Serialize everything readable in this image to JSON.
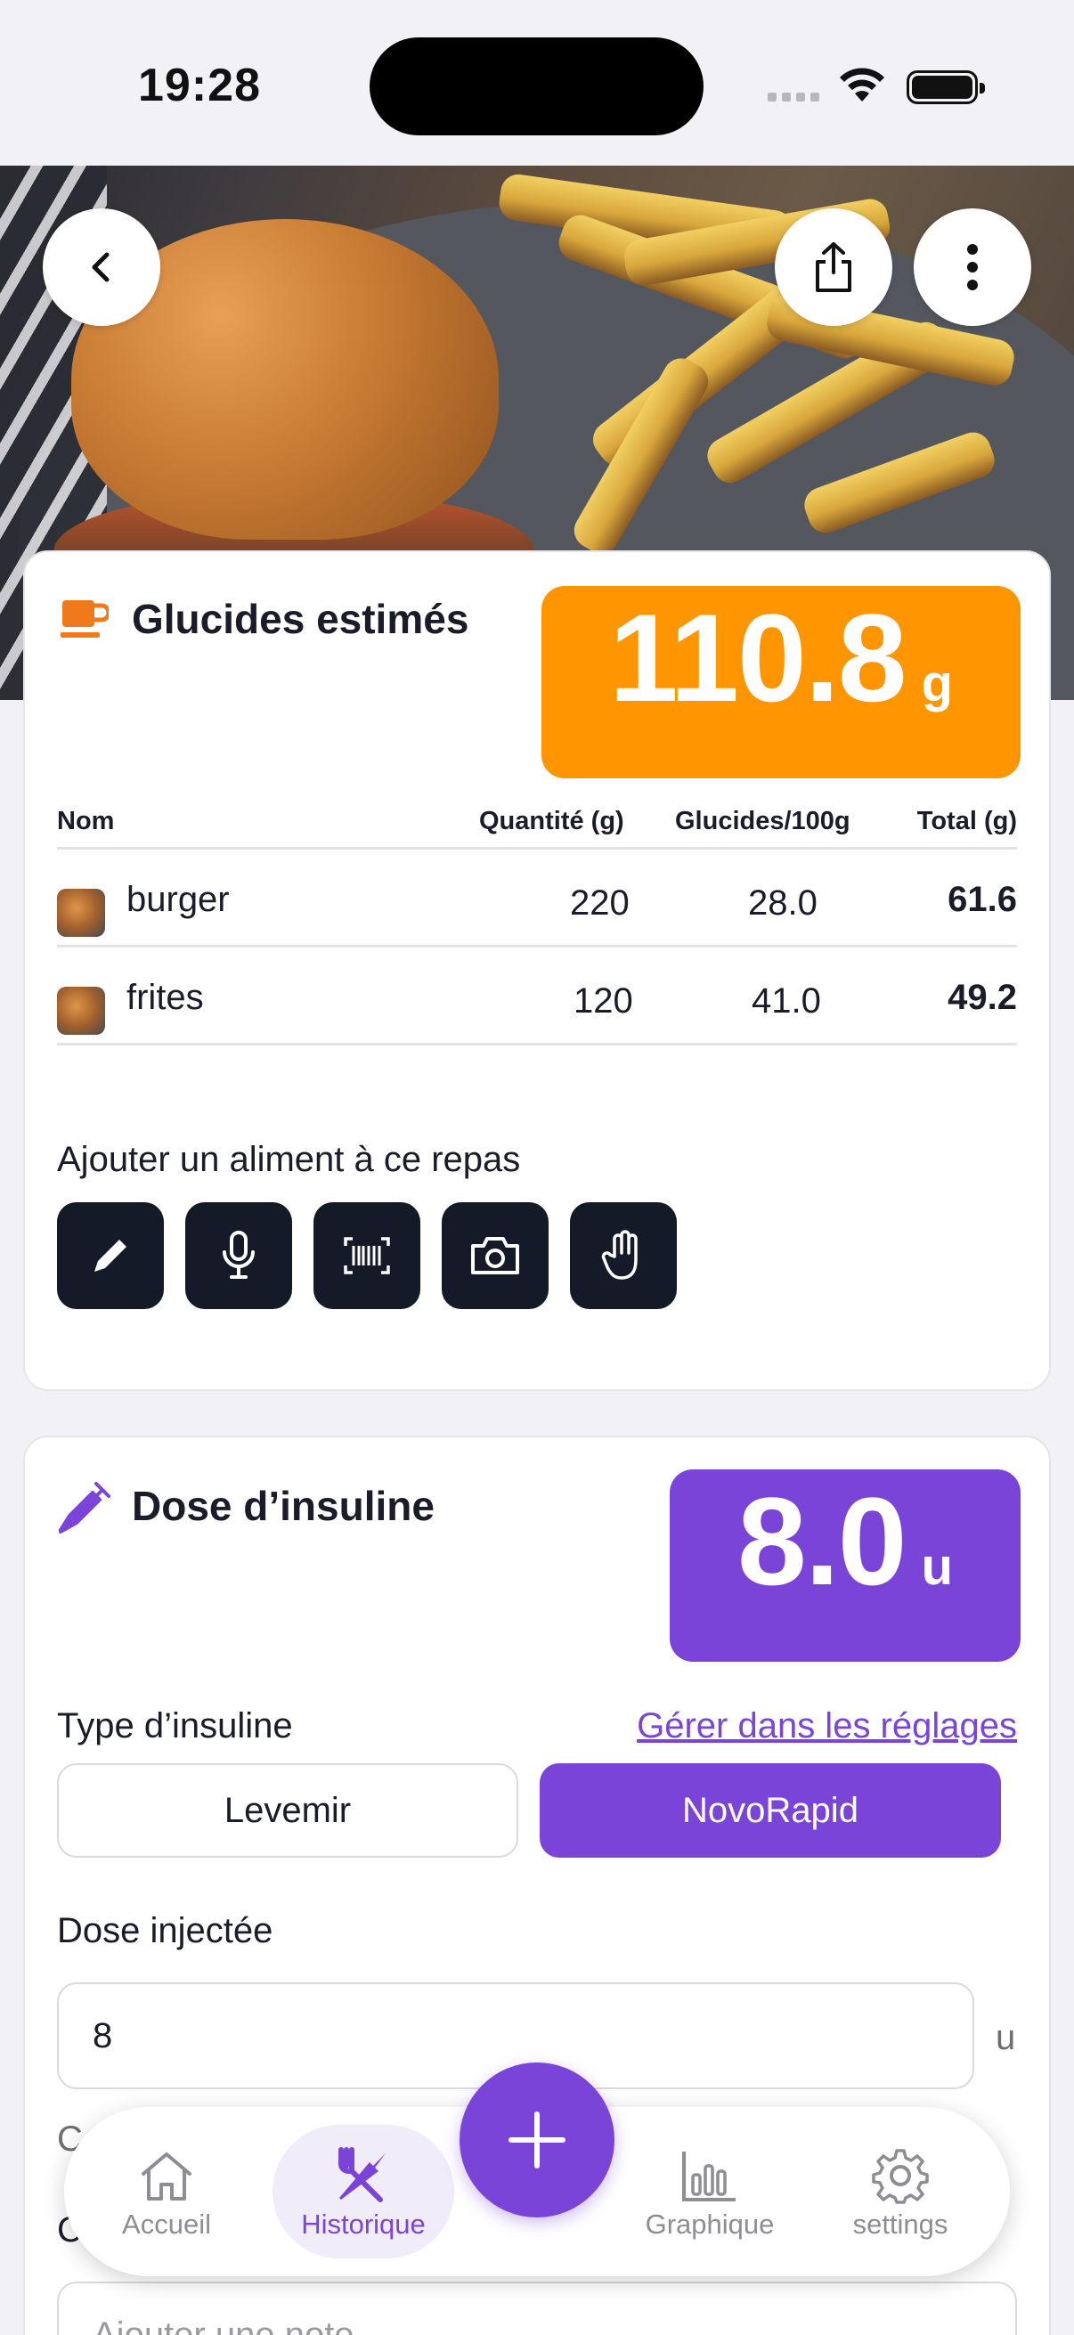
{
  "status_bar": {
    "time": "19:28"
  },
  "header": {
    "back_icon": "chevron-left-icon",
    "share_icon": "share-icon",
    "more_icon": "more-vertical-icon"
  },
  "carbs_card": {
    "title": "Glucides estimés",
    "total_value": "110.8",
    "total_unit": "g",
    "accent_color": "#ff9500",
    "columns": {
      "name": "Nom",
      "quantity": "Quantité (g)",
      "carbs_per_100g": "Glucides/100g",
      "total": "Total (g)"
    },
    "rows": [
      {
        "name": "burger",
        "quantity": "220",
        "carbs_per_100g": "28.0",
        "total": "61.6"
      },
      {
        "name": "frites",
        "quantity": "120",
        "carbs_per_100g": "41.0",
        "total": "49.2"
      }
    ],
    "add_label": "Ajouter un aliment à ce repas",
    "add_tools": [
      "pencil-icon",
      "microphone-icon",
      "barcode-icon",
      "camera-icon",
      "hand-icon"
    ]
  },
  "insulin_card": {
    "title": "Dose d’insuline",
    "dose_value": "8.0",
    "dose_unit": "u",
    "accent_color": "#7b44d8",
    "type_label": "Type d’insuline",
    "manage_link": "Gérer dans les réglages",
    "types": [
      "Levemir",
      "NovoRapid"
    ],
    "selected_type": "NovoRapid",
    "injected_label": "Dose injectée",
    "injected_value": "8",
    "injected_unit": "u",
    "partial_label_1": "C",
    "partial_label_2": "C",
    "partial_placeholder": "Ajouter une note"
  },
  "tabbar": {
    "tabs": [
      {
        "label": "Accueil",
        "icon": "home-icon"
      },
      {
        "label": "Historique",
        "icon": "fork-knife-icon"
      },
      {
        "label": "Graphique",
        "icon": "bar-chart-icon"
      },
      {
        "label": "settings",
        "icon": "gear-icon"
      }
    ],
    "active": "Historique",
    "fab_icon": "plus-icon"
  }
}
